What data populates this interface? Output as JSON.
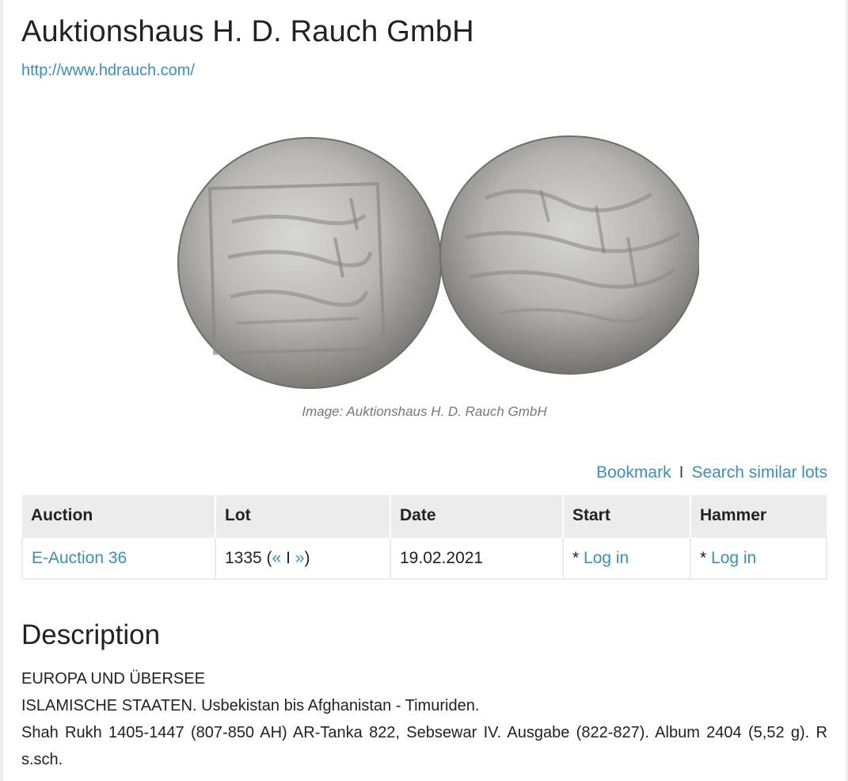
{
  "header": {
    "title": "Auktionshaus H. D. Rauch GmbH",
    "url": "http://www.hdrauch.com/"
  },
  "image": {
    "caption": "Image: Auktionshaus H. D. Rauch GmbH"
  },
  "actions": {
    "bookmark": "Bookmark",
    "separator": "I",
    "search_similar": "Search similar lots"
  },
  "table": {
    "headers": {
      "auction": "Auction",
      "lot": "Lot",
      "date": "Date",
      "start": "Start",
      "hammer": "Hammer"
    },
    "row": {
      "auction": "E-Auction 36",
      "lot_number": "1335",
      "lot_open": " (",
      "prev": "«",
      "nav_sep": " I ",
      "next": "»",
      "lot_close": ")",
      "date": "19.02.2021",
      "start_prefix": "* ",
      "start_link": "Log in",
      "hammer_prefix": "* ",
      "hammer_link": "Log in"
    }
  },
  "description": {
    "heading": "Description",
    "line1": "EUROPA UND ÜBERSEE",
    "line2": "ISLAMISCHE STAATEN. Usbekistan bis Afghanistan - Timuriden.",
    "line3": "Shah Rukh 1405-1447 (807-850 AH) AR-Tanka 822, Sebsewar IV. Ausgabe (822-827). Album 2404 (5,52 g). R s.sch."
  },
  "colors": {
    "link": "#3a8fc0",
    "header_bg": "#ececec",
    "text": "#222222",
    "caption": "#777777"
  }
}
